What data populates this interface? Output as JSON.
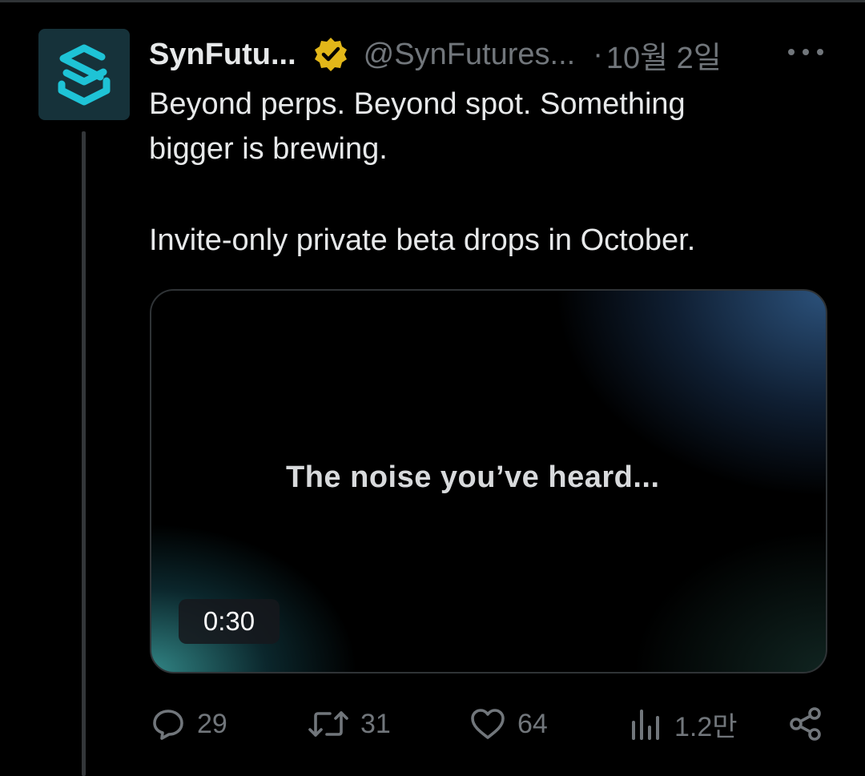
{
  "tweet": {
    "display_name": "SynFutu...",
    "handle": "@SynFutures...",
    "separator": "·",
    "date": "10월 2일",
    "verified": true,
    "text_line_1": "Beyond perps. Beyond spot. Something",
    "text_line_2": "bigger is brewing.",
    "text_line_3": "Invite-only private beta drops in October."
  },
  "media": {
    "type": "video",
    "caption": "The noise you’ve heard...",
    "duration": "0:30"
  },
  "actions": {
    "replies": "29",
    "reposts": "31",
    "likes": "64",
    "views": "1.2만"
  },
  "colors": {
    "background": "#000000",
    "text": "#e7e9ea",
    "muted": "#71767b",
    "verified_gold": "#e2b719",
    "brand_teal": "#1ec3d6"
  },
  "icons": {
    "avatar": "synfutures-logo-icon",
    "verified": "verified-badge-icon",
    "more": "more-horizontal-icon",
    "reply": "reply-icon",
    "repost": "repost-icon",
    "like": "heart-icon",
    "views": "views-icon",
    "share": "share-icon"
  }
}
